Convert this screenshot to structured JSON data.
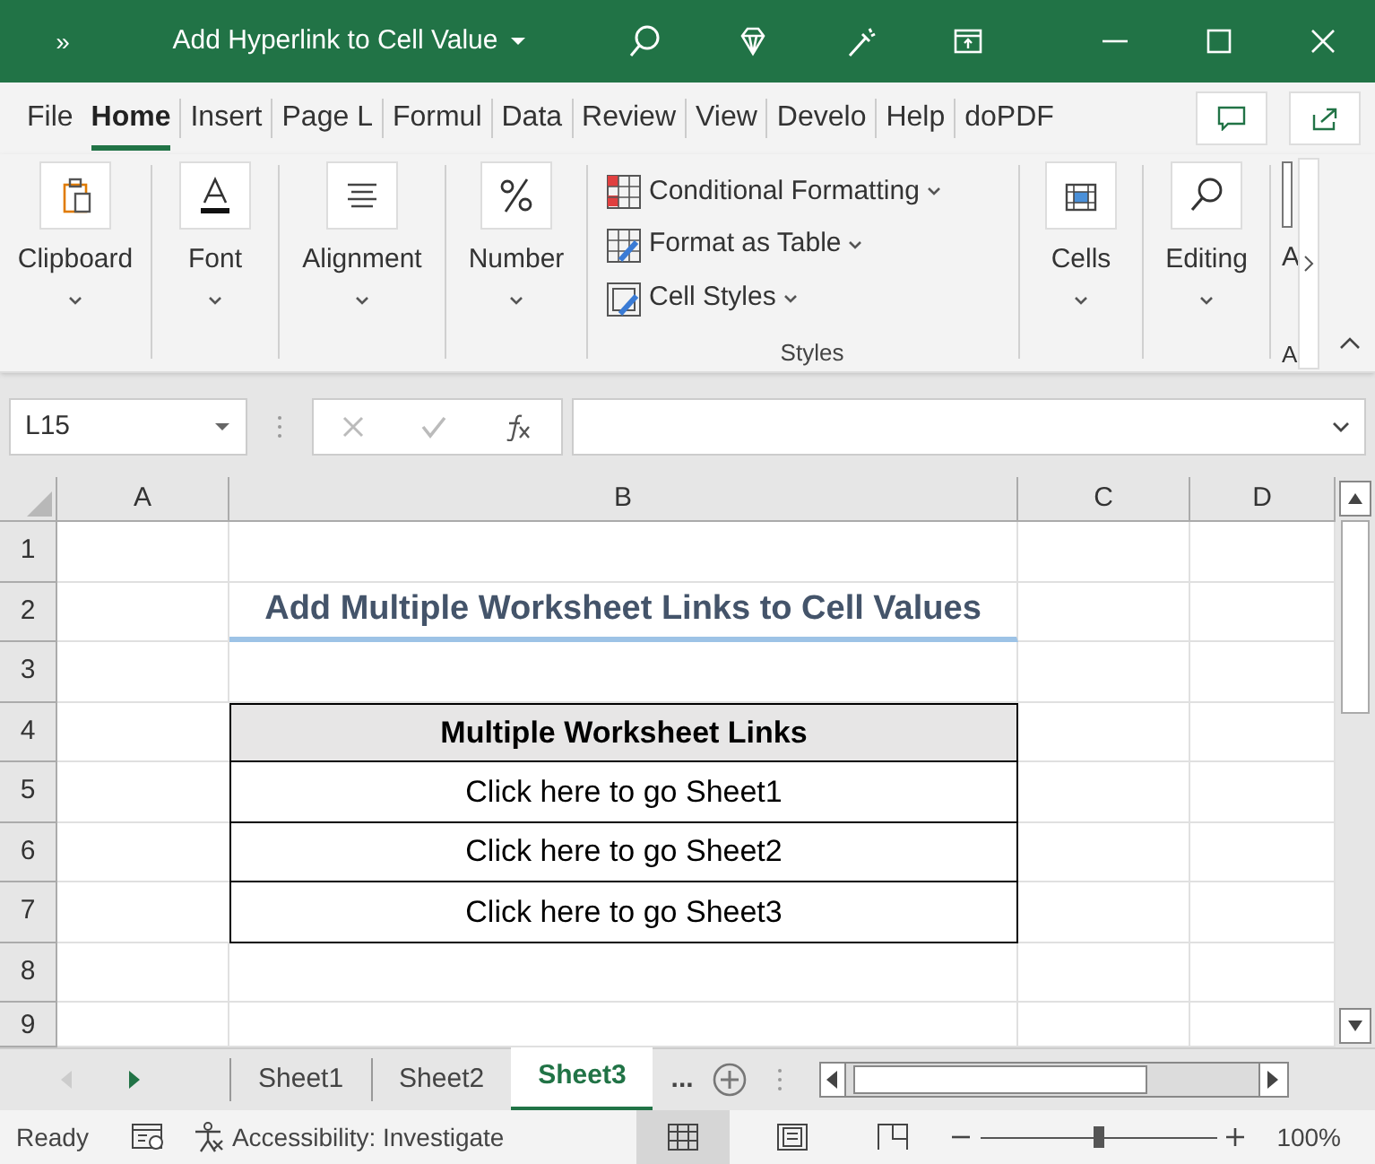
{
  "window": {
    "title": "Add Hyperlink to Cell Value",
    "qat": "»"
  },
  "ribbon_tabs": [
    {
      "label": "File",
      "selected": false
    },
    {
      "label": "Home",
      "selected": true
    },
    {
      "label": "Insert",
      "selected": false
    },
    {
      "label": "Page L",
      "selected": false
    },
    {
      "label": "Formul",
      "selected": false
    },
    {
      "label": "Data",
      "selected": false
    },
    {
      "label": "Review",
      "selected": false
    },
    {
      "label": "View",
      "selected": false
    },
    {
      "label": "Develo",
      "selected": false
    },
    {
      "label": "Help",
      "selected": false
    },
    {
      "label": "doPDF",
      "selected": false
    }
  ],
  "ribbon_groups": [
    {
      "kind": "big",
      "label": "Clipboard"
    },
    {
      "kind": "big",
      "label": "Font"
    },
    {
      "kind": "big",
      "label": "Alignment"
    },
    {
      "kind": "big",
      "label": "Number"
    },
    {
      "kind": "styles",
      "label": "Styles",
      "items": [
        "Conditional Formatting",
        "Format as Table",
        "Cell Styles"
      ]
    },
    {
      "kind": "big",
      "label": "Cells"
    },
    {
      "kind": "big",
      "label": "Editing"
    },
    {
      "kind": "cut",
      "label": "A",
      "group_label": "A"
    }
  ],
  "formula_bar": {
    "name_box": "L15"
  },
  "columns": [
    "A",
    "B",
    "C",
    "D"
  ],
  "rows": [
    {
      "number": "1",
      "kind": "plain",
      "cells": [
        "",
        "",
        "",
        ""
      ]
    },
    {
      "number": "2",
      "kind": "title",
      "cells": [
        "",
        "Add Multiple Worksheet Links to Cell Values",
        "",
        ""
      ]
    },
    {
      "number": "3",
      "kind": "plain",
      "cells": [
        "",
        "",
        "",
        ""
      ]
    },
    {
      "number": "4",
      "kind": "header",
      "cells": [
        "",
        "Multiple Worksheet Links",
        "",
        ""
      ]
    },
    {
      "number": "5",
      "kind": "boxed",
      "cells": [
        "",
        "Click here to go Sheet1",
        "",
        ""
      ]
    },
    {
      "number": "6",
      "kind": "boxed",
      "cells": [
        "",
        "Click here to go Sheet2",
        "",
        ""
      ]
    },
    {
      "number": "7",
      "kind": "boxed",
      "cells": [
        "",
        "Click here to go Sheet3",
        "",
        ""
      ]
    },
    {
      "number": "8",
      "kind": "plain",
      "cells": [
        "",
        "",
        "",
        ""
      ]
    },
    {
      "number": "9",
      "kind": "plain",
      "cells": [
        "",
        "",
        "",
        ""
      ]
    }
  ],
  "sheet_tabs": [
    {
      "label": "Sheet1",
      "selected": false
    },
    {
      "label": "Sheet2",
      "selected": false
    },
    {
      "label": "Sheet3",
      "selected": true
    }
  ],
  "more_sheets": "...",
  "status_bar": {
    "mode": "Ready",
    "accessibility": "Accessibility: Investigate",
    "zoom": "100%",
    "zoom_level": {
      "level": 0.5
    }
  }
}
